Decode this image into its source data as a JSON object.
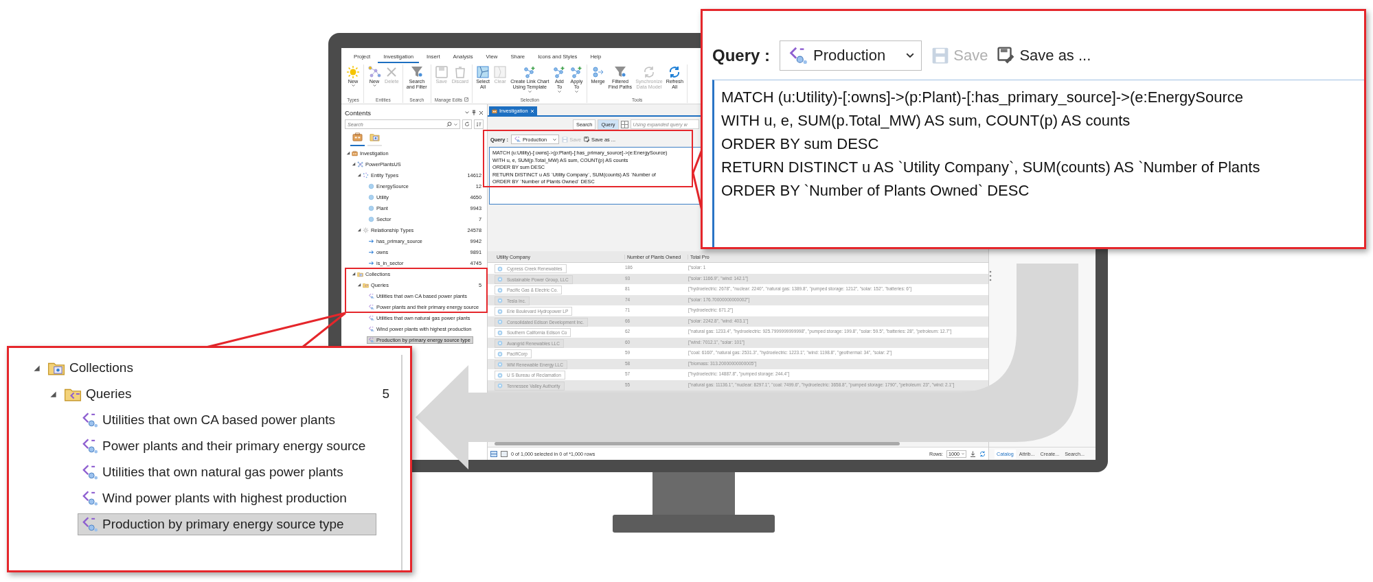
{
  "ribbon": {
    "tabs": [
      {
        "label": "Project",
        "selected": false
      },
      {
        "label": "Investigation",
        "selected": true
      },
      {
        "label": "Insert",
        "selected": false
      },
      {
        "label": "Analysis",
        "selected": false
      },
      {
        "label": "View",
        "selected": false
      },
      {
        "label": "Share",
        "selected": false
      },
      {
        "label": "Icons and Styles",
        "selected": false
      },
      {
        "label": "Help",
        "selected": false
      }
    ],
    "groups": [
      {
        "label": "Types",
        "buttons": [
          {
            "label": "New",
            "disabled": false,
            "dropdown": true
          }
        ]
      },
      {
        "label": "Entities",
        "buttons": [
          {
            "label": "New",
            "disabled": false,
            "dropdown": true
          },
          {
            "label": "Delete",
            "disabled": true,
            "dropdown": false
          }
        ]
      },
      {
        "label": "Search",
        "buttons": [
          {
            "label": "Search\nand Filter",
            "disabled": false,
            "dropdown": false
          }
        ]
      },
      {
        "label": "Manage Edits",
        "launcher": true,
        "buttons": [
          {
            "label": "Save",
            "disabled": true,
            "dropdown": false
          },
          {
            "label": "Discard",
            "disabled": true,
            "dropdown": false
          }
        ]
      },
      {
        "label": "Selection",
        "buttons": [
          {
            "label": "Select\nAll",
            "disabled": false,
            "dropdown": false
          },
          {
            "label": "Clear",
            "disabled": true,
            "dropdown": false
          },
          {
            "label": "Create Link Chart\nUsing Template",
            "disabled": false,
            "dropdown": true
          },
          {
            "label": "Add\nTo",
            "disabled": false,
            "dropdown": true
          },
          {
            "label": "Apply\nTo",
            "disabled": false,
            "dropdown": true
          }
        ]
      },
      {
        "label": "Tools",
        "buttons": [
          {
            "label": "Merge",
            "disabled": false,
            "dropdown": false
          },
          {
            "label": "Filtered\nFind Paths",
            "disabled": false,
            "dropdown": false
          },
          {
            "label": "Synchronize\nData Model",
            "disabled": true,
            "dropdown": false
          },
          {
            "label": "Refresh\nAll",
            "disabled": false,
            "dropdown": false
          }
        ]
      }
    ]
  },
  "contents": {
    "title": "Contents",
    "search_placeholder": "Search",
    "view_tabs": [
      {
        "selected": true
      },
      {
        "selected": false
      }
    ],
    "tree": [
      {
        "label": "Investigation",
        "kind": "investigation",
        "expanded": true,
        "children": [
          {
            "label": "PowerPlantsUS",
            "kind": "dataset",
            "expanded": true,
            "children": [
              {
                "label": "Entity Types",
                "kind": "entity-types",
                "count": "14612",
                "expanded": true,
                "children": [
                  {
                    "label": "EnergySource",
                    "kind": "entity",
                    "count": "12"
                  },
                  {
                    "label": "Utility",
                    "kind": "entity",
                    "count": "4650"
                  },
                  {
                    "label": "Plant",
                    "kind": "entity",
                    "count": "9943"
                  },
                  {
                    "label": "Sector",
                    "kind": "entity",
                    "count": "7"
                  }
                ]
              },
              {
                "label": "Relationship Types",
                "kind": "relationship-types",
                "count": "24578",
                "expanded": true,
                "children": [
                  {
                    "label": "has_primary_source",
                    "kind": "relationship",
                    "count": "9942"
                  },
                  {
                    "label": "owns",
                    "kind": "relationship",
                    "count": "9891"
                  },
                  {
                    "label": "is_in_sector",
                    "kind": "relationship",
                    "count": "4745"
                  }
                ]
              }
            ]
          },
          {
            "label": "Collections",
            "kind": "collections",
            "expanded": true,
            "children": [
              {
                "label": "Queries",
                "kind": "queries",
                "count": "5",
                "expanded": true,
                "children": [
                  {
                    "label": "Utilities that own CA based power plants",
                    "kind": "query",
                    "selected": false
                  },
                  {
                    "label": "Power plants and their primary energy source",
                    "kind": "query",
                    "selected": false
                  },
                  {
                    "label": "Utilities that own natural gas power plants",
                    "kind": "query",
                    "selected": false
                  },
                  {
                    "label": "Wind power plants with highest production",
                    "kind": "query",
                    "selected": false
                  },
                  {
                    "label": "Production by primary energy source type",
                    "kind": "query",
                    "selected": true
                  }
                ]
              }
            ]
          }
        ]
      }
    ]
  },
  "investigation": {
    "tab": "Investigation",
    "modes": [
      {
        "label": "Search",
        "selected": false
      },
      {
        "label": "Query",
        "selected": true
      }
    ],
    "expanded_query_placeholder": "Using expanded query w",
    "query_label": "Query :",
    "query_name": "Production",
    "actions": [
      {
        "label": "Save",
        "disabled": true
      },
      {
        "label": "Save as ...",
        "disabled": false
      }
    ],
    "query_lines": [
      "MATCH (u:Utility)-[:owns]->(p:Plant)-[:has_primary_source]->(e:EnergySource)",
      "WITH u, e, SUM(p.Total_MW) AS sum, COUNT(p) AS counts",
      "ORDER BY sum DESC",
      "RETURN DISTINCT u AS `Utility Company`, SUM(counts) AS `Number of",
      "ORDER BY `Number of Plants Owned` DESC"
    ],
    "table": {
      "columns": [
        "Utility Company",
        "Number of Plants Owned",
        "Total Pro"
      ],
      "rows": [
        [
          "Cypress Creek Renewables",
          "186",
          "[\"solar: 1"
        ],
        [
          "Sustainable Power Group, LLC",
          "93",
          "[\"solar: 1166.9\", \"wind: 142.1\"]"
        ],
        [
          "Pacific Gas & Electric Co.",
          "81",
          "[\"hydroelectric: 2678\", \"nuclear: 2240\", \"natural gas: 1389.8\", \"pumped storage: 1212\", \"solar: 152\", \"batteries: 6\"]"
        ],
        [
          "Tesla Inc.",
          "74",
          "[\"solar: 176.70000000000002\"]"
        ],
        [
          "Erie Boulevard Hydropower LP",
          "71",
          "[\"hydroelectric: 671.2\"]"
        ],
        [
          "Consolidated Edison Development Inc.",
          "66",
          "[\"solar: 2242.8\", \"wind: 403.1\"]"
        ],
        [
          "Southern California Edison Co",
          "62",
          "[\"natural gas: 1233.4\", \"hydroelectric: 925.7999999999998\", \"pumped storage: 199.8\", \"solar: 59.5\", \"batteries: 28\", \"petroleum: 12.7\"]"
        ],
        [
          "Avangrid Renewables LLC",
          "60",
          "[\"wind: 7012.1\", \"solar: 101\"]"
        ],
        [
          "PacifiCorp",
          "59",
          "[\"coal: 6160\", \"natural gas: 2531.3\", \"hydroelectric: 1223.1\", \"wind: 1198.8\", \"geothermal: 34\", \"solar: 2\"]"
        ],
        [
          "WM Renewable Energy LLC",
          "58",
          "[\"biomass: 313.20000000000005\"]"
        ],
        [
          "U S Bureau of Reclamation",
          "57",
          "[\"hydroelectric: 14887.8\", \"pumped storage: 244.4\"]"
        ],
        [
          "Tennessee Valley Authority",
          "55",
          "[\"natural gas: 11136.1\", \"nuclear: 8297.1\", \"coal: 7499.6\", \"hydroelectric: 3658.8\", \"pumped storage: 1790\", \"petroleum: 23\", \"wind: 2.1\"]"
        ]
      ]
    },
    "status": "0 of 1,000 selected in 0 of *1,000 rows",
    "rows_label": "Rows:",
    "rows_value": "1000"
  },
  "dock_tabs": [
    {
      "label": "Catalog",
      "selected": true
    },
    {
      "label": "Attrib...",
      "selected": false
    },
    {
      "label": "Create...",
      "selected": false
    },
    {
      "label": "Search...",
      "selected": false
    }
  ],
  "query_callout": {
    "query_label": "Query :",
    "query_name": "Production",
    "actions": [
      {
        "label": "Save",
        "disabled": true
      },
      {
        "label": "Save as ...",
        "disabled": false
      }
    ],
    "lines": [
      "MATCH (u:Utility)-[:owns]->(p:Plant)-[:has_primary_source]->(e:EnergySource",
      "WITH u, e, SUM(p.Total_MW) AS sum, COUNT(p) AS counts",
      "ORDER BY sum DESC",
      "RETURN DISTINCT u AS `Utility Company`, SUM(counts) AS `Number of Plants",
      "ORDER BY `Number of Plants Owned` DESC"
    ]
  },
  "collections_callout": {
    "tree": [
      {
        "label": "Collections",
        "kind": "collections",
        "expanded": true,
        "children": [
          {
            "label": "Queries",
            "kind": "queries",
            "count": "5",
            "expanded": true,
            "children": [
              {
                "label": "Utilities that own CA based power plants",
                "kind": "query",
                "selected": false
              },
              {
                "label": "Power plants and their primary energy source",
                "kind": "query",
                "selected": false
              },
              {
                "label": "Utilities that own natural gas power plants",
                "kind": "query",
                "selected": false
              },
              {
                "label": "Wind power plants with highest production",
                "kind": "query",
                "selected": false
              },
              {
                "label": "Production by primary energy source type",
                "kind": "query",
                "selected": true
              }
            ]
          }
        ]
      }
    ]
  }
}
